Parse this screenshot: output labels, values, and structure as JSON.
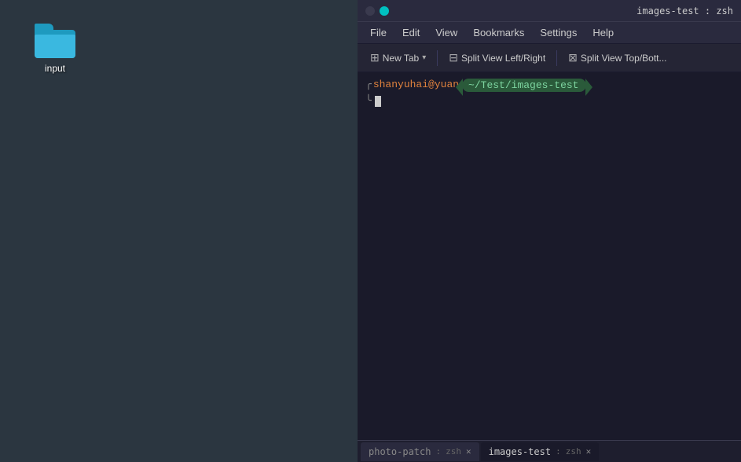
{
  "desktop": {
    "background_color": "#2b3640",
    "icon": {
      "label": "input",
      "type": "folder"
    }
  },
  "terminal": {
    "title": "images-test : zsh",
    "title_bar": {
      "dot1_type": "inactive",
      "dot2_type": "active"
    },
    "menu": {
      "items": [
        "File",
        "Edit",
        "View",
        "Bookmarks",
        "Settings",
        "Help"
      ]
    },
    "toolbar": {
      "buttons": [
        {
          "id": "new-tab",
          "icon": "⊞",
          "label": "New Tab",
          "has_dropdown": true
        },
        {
          "id": "split-lr",
          "icon": "⊟",
          "label": "Split View Left/Right"
        },
        {
          "id": "split-tb",
          "icon": "⊠",
          "label": "Split View Top/Bott..."
        }
      ]
    },
    "prompt": {
      "user": "shanyuhai@yuan",
      "path": "~/Test/images-test"
    },
    "tabs": [
      {
        "id": "tab1",
        "label": "photo-patch",
        "shell": "zsh",
        "active": false
      },
      {
        "id": "tab2",
        "label": "images-test",
        "shell": "zsh",
        "active": true
      }
    ]
  }
}
